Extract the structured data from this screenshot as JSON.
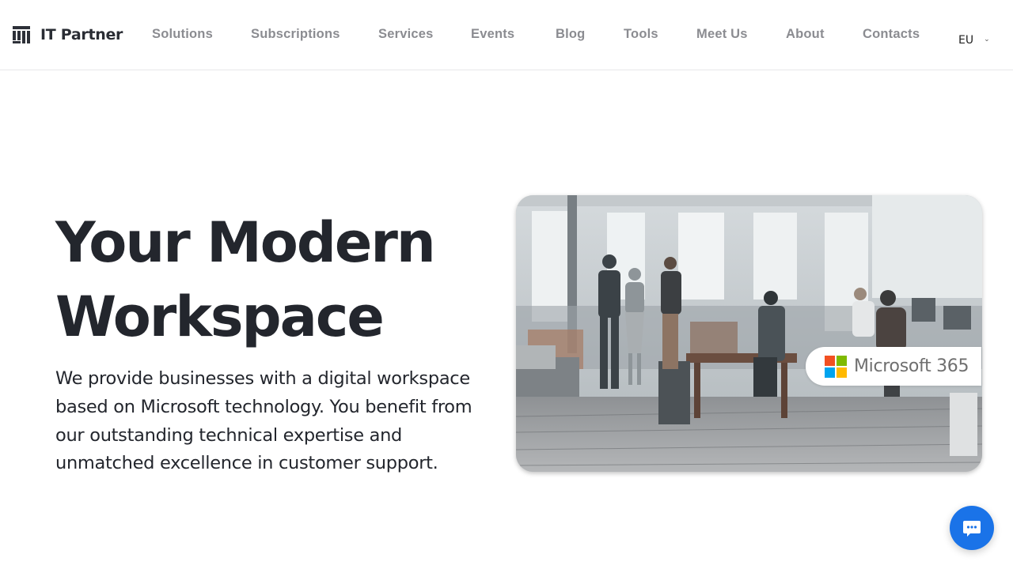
{
  "brand": {
    "name": "IT Partner",
    "logo_icon": "building-columns-icon"
  },
  "nav": {
    "items": [
      {
        "label": "Solutions"
      },
      {
        "label": "Subscriptions"
      },
      {
        "label": "Services"
      },
      {
        "label": "Events"
      },
      {
        "label": "Blog"
      },
      {
        "label": "Tools"
      },
      {
        "label": "Meet Us"
      },
      {
        "label": "About"
      },
      {
        "label": "Contacts"
      }
    ],
    "region_selector": {
      "value": "EU",
      "icon": "chevron-down-icon"
    }
  },
  "hero": {
    "title_line1": "Your Modern",
    "title_line2": "Workspace",
    "description": "We provide businesses with a digital workspace based on Microsoft technology. You benefit from our outstanding technical expertise and unmatched excellence in customer support.",
    "image_alt": "Team working in a modern open-plan office",
    "badge": {
      "text": "Microsoft 365",
      "logo_colors": [
        "#f25022",
        "#7fba00",
        "#00a4ef",
        "#ffb900"
      ]
    }
  },
  "chat": {
    "icon": "chat-bubble-icon",
    "color": "#1a73e8"
  },
  "colors": {
    "heading": "#23262d",
    "nav_text": "#8b8c91",
    "accent": "#1a73e8"
  }
}
